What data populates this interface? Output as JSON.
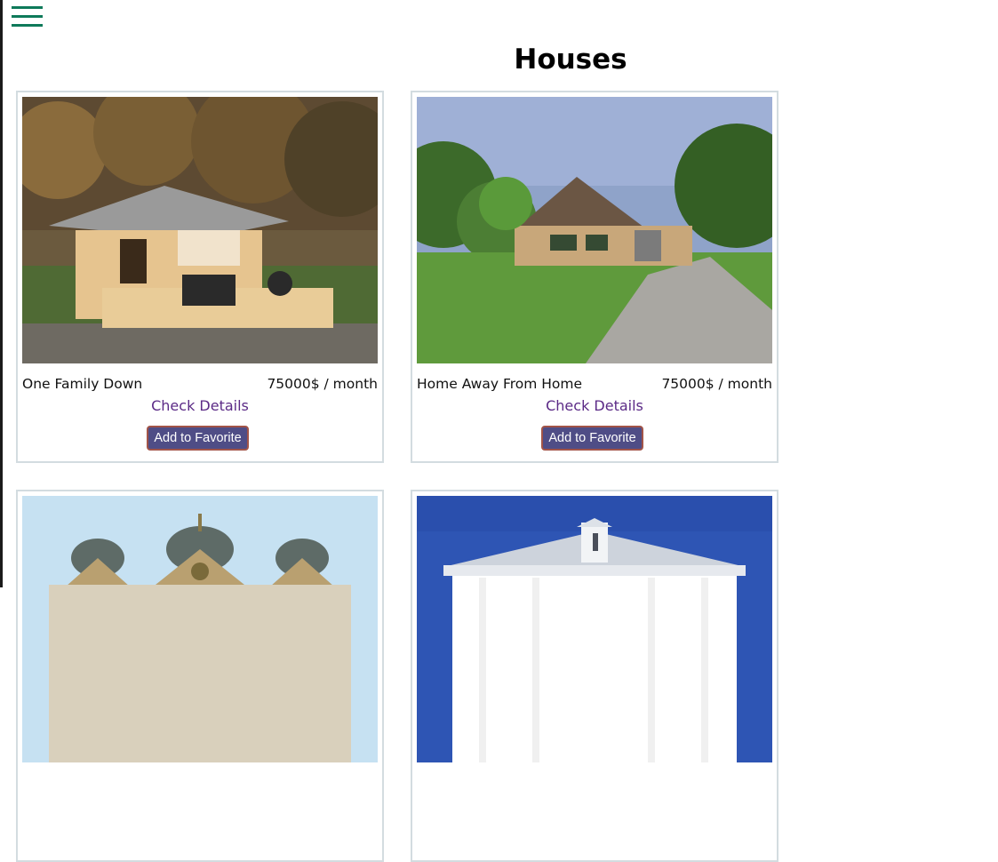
{
  "nav": {
    "menu_icon": "hamburger-menu-icon"
  },
  "page": {
    "title": "Houses"
  },
  "colors": {
    "accent": "#0e7a5a",
    "link": "#5b2a86",
    "button_bg": "#4f4d86",
    "button_border": "#a25448",
    "card_border": "#d3dce0"
  },
  "listings": [
    {
      "name": "One Family Down",
      "price": "75000$ / month",
      "details_label": "Check Details",
      "favorite_label": "Add to Favorite"
    },
    {
      "name": "Home Away From Home",
      "price": "75000$ / month",
      "details_label": "Check Details",
      "favorite_label": "Add to Favorite"
    },
    {
      "name": "",
      "price": "",
      "details_label": "",
      "favorite_label": ""
    },
    {
      "name": "",
      "price": "",
      "details_label": "",
      "favorite_label": ""
    }
  ]
}
